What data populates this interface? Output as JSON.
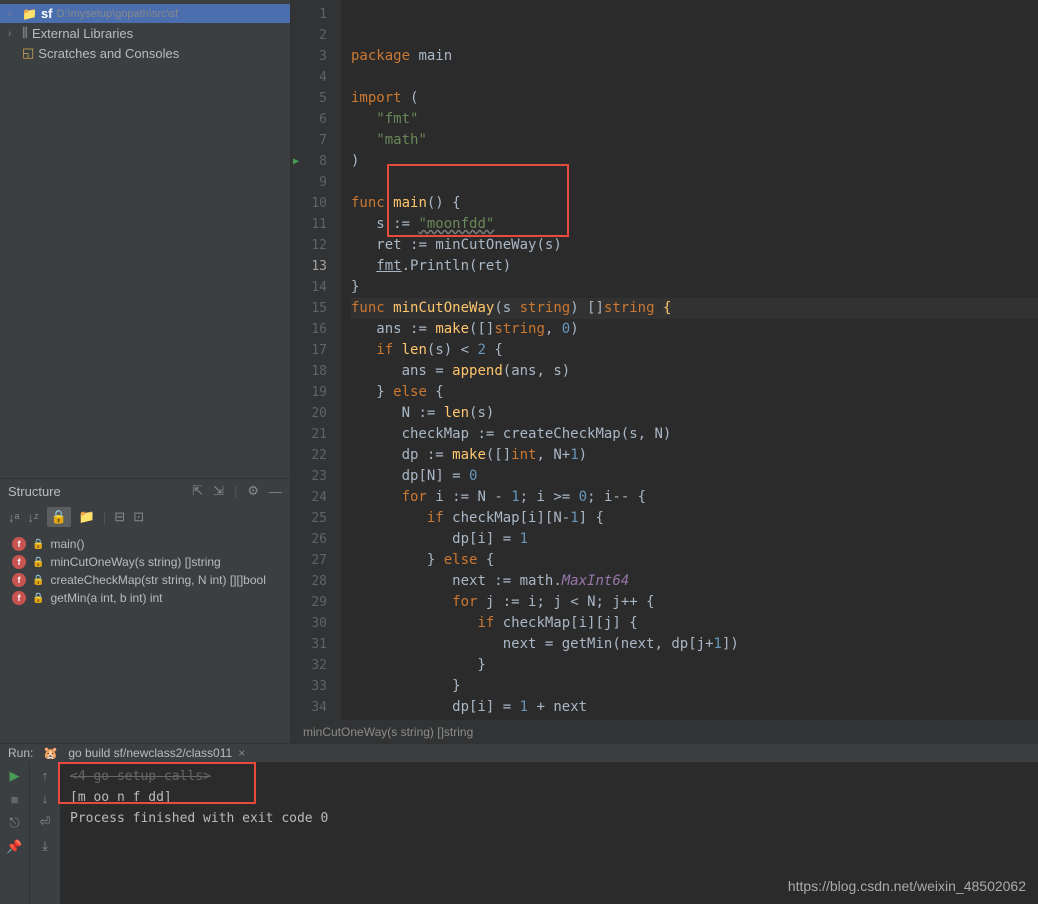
{
  "project_tree": {
    "root": {
      "name": "sf",
      "path": "D:\\mysetup\\gopath\\src\\sf"
    },
    "external_libs": "External Libraries",
    "scratches": "Scratches and Consoles"
  },
  "structure": {
    "title": "Structure",
    "items": [
      {
        "name": "main()"
      },
      {
        "name": "minCutOneWay(s string) []string"
      },
      {
        "name": "createCheckMap(str string, N int) [][]bool"
      },
      {
        "name": "getMin(a int, b int) int"
      }
    ]
  },
  "editor": {
    "lines": [
      {
        "n": 1,
        "html": "<span class='kw'>package</span> <span class='ident'>main</span>"
      },
      {
        "n": 2,
        "html": ""
      },
      {
        "n": 3,
        "html": "<span class='kw'>import</span> <span class='paren'>(</span>"
      },
      {
        "n": 4,
        "html": "   <span class='str'>\"fmt\"</span>"
      },
      {
        "n": 5,
        "html": "   <span class='str'>\"math\"</span>"
      },
      {
        "n": 6,
        "html": "<span class='paren'>)</span>"
      },
      {
        "n": 7,
        "html": ""
      },
      {
        "n": 8,
        "html": "<span class='kw'>func</span> <span class='fn'>main</span><span class='paren'>() {</span>",
        "run": true
      },
      {
        "n": 9,
        "html": "   <span class='ident'>s</span> := <span class='str-u'>\"moonfdd\"</span>"
      },
      {
        "n": 10,
        "html": "   <span class='ident'>ret</span> := <span class='ident'>minCutOneWay</span>(<span class='ident'>s</span>)"
      },
      {
        "n": 11,
        "html": "   <span class='pkg'>fmt</span>.<span class='ident'>Println</span>(<span class='ident'>ret</span>)"
      },
      {
        "n": 12,
        "html": "<span class='paren'>}</span>"
      },
      {
        "n": 13,
        "html": "<span class='kw'>func</span> <span class='fn'>minCutOneWay</span>(<span class='ident'>s</span> <span class='type'>string</span>) []<span class='type'>string</span> <span class='cursor-br'>{</span>",
        "current": true
      },
      {
        "n": 14,
        "html": "   <span class='ident'>ans</span> := <span class='fn'>make</span>([]<span class='type'>string</span>, <span class='num'>0</span>)"
      },
      {
        "n": 15,
        "html": "   <span class='kw'>if</span> <span class='fn'>len</span>(<span class='ident'>s</span>) < <span class='num'>2</span> {"
      },
      {
        "n": 16,
        "html": "      <span class='ident'>ans</span> = <span class='fn'>append</span>(<span class='ident'>ans</span>, <span class='ident'>s</span>)"
      },
      {
        "n": 17,
        "html": "   } <span class='kw'>else</span> {"
      },
      {
        "n": 18,
        "html": "      <span class='ident'>N</span> := <span class='fn'>len</span>(<span class='ident'>s</span>)"
      },
      {
        "n": 19,
        "html": "      <span class='ident'>checkMap</span> := <span class='ident'>createCheckMap</span>(<span class='ident'>s</span>, <span class='ident'>N</span>)"
      },
      {
        "n": 20,
        "html": "      <span class='ident'>dp</span> := <span class='fn'>make</span>([]<span class='type'>int</span>, <span class='ident'>N</span>+<span class='num'>1</span>)"
      },
      {
        "n": 21,
        "html": "      <span class='ident'>dp</span>[<span class='ident'>N</span>] = <span class='num'>0</span>"
      },
      {
        "n": 22,
        "html": "      <span class='kw'>for</span> <span class='ident'>i</span> := <span class='ident'>N</span> - <span class='num'>1</span>; <span class='ident'>i</span> >= <span class='num'>0</span>; <span class='ident'>i</span>-- {"
      },
      {
        "n": 23,
        "html": "         <span class='kw'>if</span> <span class='ident'>checkMap</span>[<span class='ident'>i</span>][<span class='ident'>N</span>-<span class='num'>1</span>] {"
      },
      {
        "n": 24,
        "html": "            <span class='ident'>dp</span>[<span class='ident'>i</span>] = <span class='num'>1</span>"
      },
      {
        "n": 25,
        "html": "         } <span class='kw'>else</span> {"
      },
      {
        "n": 26,
        "html": "            <span class='ident'>next</span> := <span class='ident'>math</span>.<span class='ident' style='font-style:italic;color:#9876aa'>MaxInt64</span>"
      },
      {
        "n": 27,
        "html": "            <span class='kw'>for</span> <span class='ident'>j</span> := <span class='ident'>i</span>; <span class='ident'>j</span> < <span class='ident'>N</span>; <span class='ident'>j</span>++ {"
      },
      {
        "n": 28,
        "html": "               <span class='kw'>if</span> <span class='ident'>checkMap</span>[<span class='ident'>i</span>][<span class='ident'>j</span>] {"
      },
      {
        "n": 29,
        "html": "                  <span class='ident'>next</span> = <span class='ident'>getMin</span>(<span class='ident'>next</span>, <span class='ident'>dp</span>[<span class='ident'>j</span>+<span class='num'>1</span>])"
      },
      {
        "n": 30,
        "html": "               }"
      },
      {
        "n": 31,
        "html": "            }"
      },
      {
        "n": 32,
        "html": "            <span class='ident'>dp</span>[<span class='ident'>i</span>] = <span class='num'>1</span> + <span class='ident'>next</span>"
      },
      {
        "n": 33,
        "html": "         }"
      },
      {
        "n": 34,
        "html": "      }"
      }
    ],
    "breadcrumb": "minCutOneWay(s string) []string"
  },
  "run": {
    "label": "Run:",
    "config": "go build sf/newclass2/class011",
    "output_dim": "<4 go setup calls>",
    "output_line1": "[m oo n f dd]",
    "output_line2": "",
    "output_line3": "Process finished with exit code 0"
  },
  "watermark": "https://blog.csdn.net/weixin_48502062"
}
